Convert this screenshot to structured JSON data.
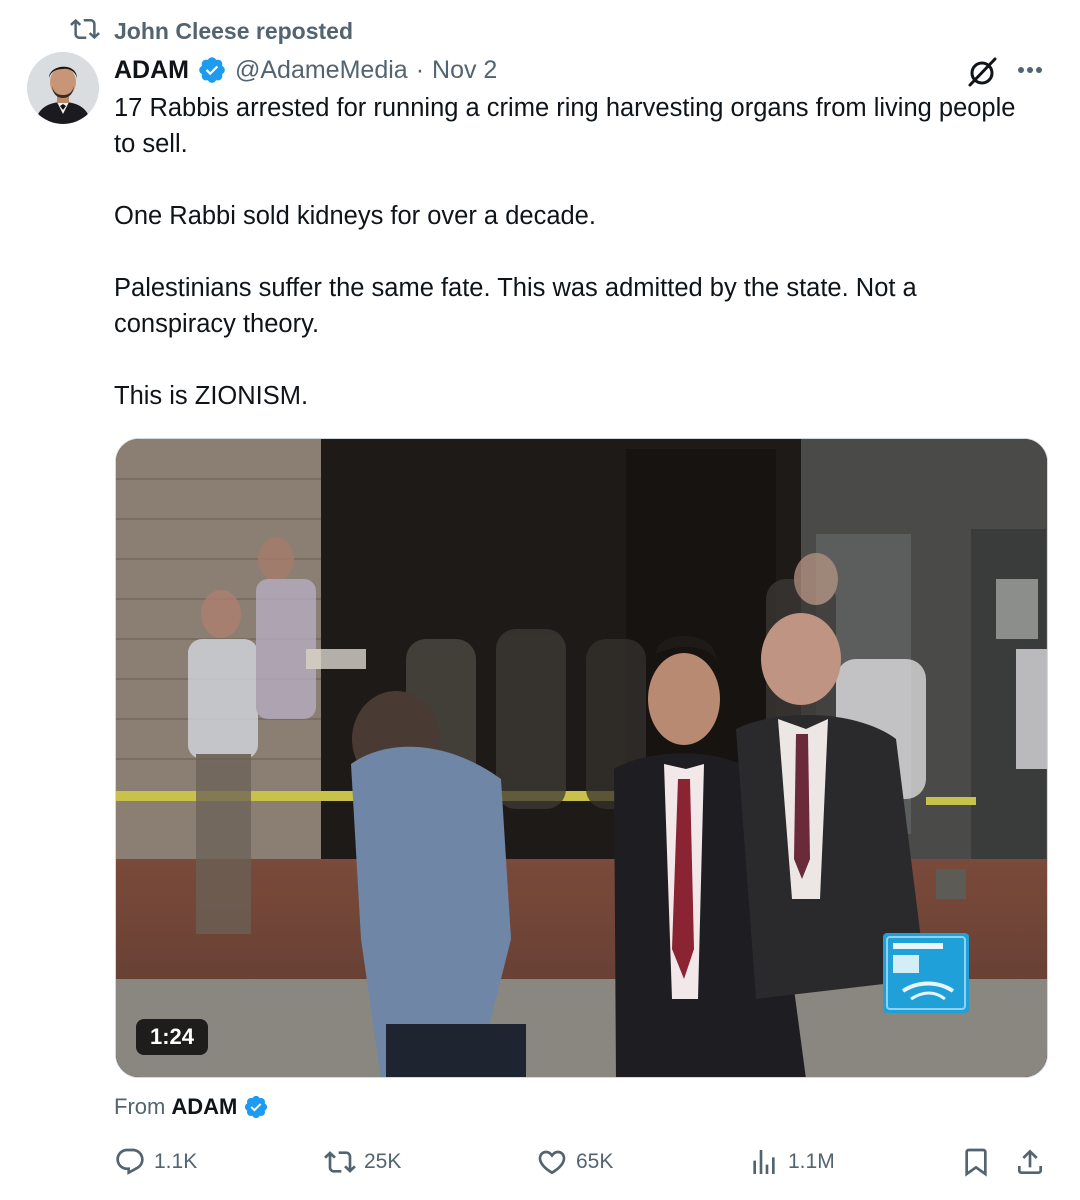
{
  "repost_banner": {
    "text": "John Cleese reposted",
    "icon": "repost-icon"
  },
  "author": {
    "name": "ADAM",
    "handle": "@AdameMedia",
    "separator": "·",
    "date": "Nov 2",
    "verified": true,
    "verified_color": "#1d9bf0"
  },
  "tweet": {
    "paragraphs": [
      "17 Rabbis arrested for running a crime ring harvesting organs from living people to sell.",
      "One Rabbi sold kidneys for over a decade.",
      "Palestinians suffer the same fate. This was admitted by the state. Not a conspiracy theory.",
      "This is ZIONISM."
    ]
  },
  "media": {
    "type": "video",
    "duration": "1:24",
    "channel_logo": "france24-logo-icon"
  },
  "from_line": {
    "prefix": "From",
    "name": "ADAM"
  },
  "actions": {
    "replies": "1.1K",
    "reposts": "25K",
    "likes": "65K",
    "views": "1.1M"
  },
  "colors": {
    "text_primary": "#0f1419",
    "text_secondary": "#536471",
    "accent": "#1d9bf0"
  }
}
